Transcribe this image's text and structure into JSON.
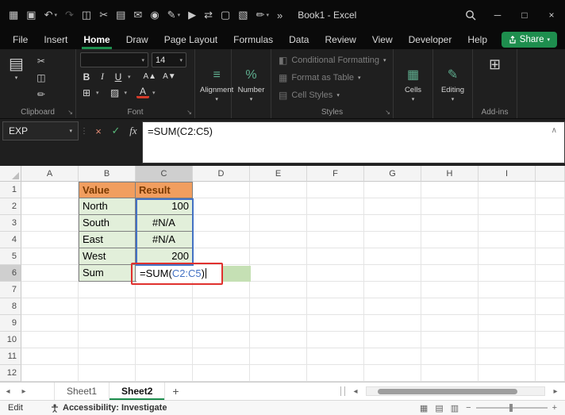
{
  "titlebar": {
    "title": "Book1 - Excel",
    "qat": [
      {
        "name": "app-grid-icon",
        "glyph": "▦"
      },
      {
        "name": "save-icon",
        "glyph": "▣"
      },
      {
        "name": "undo-icon",
        "glyph": "↶",
        "dropdown": true
      },
      {
        "name": "redo-icon",
        "glyph": "↷",
        "dim": true
      },
      {
        "name": "copy-book-icon",
        "glyph": "◫"
      },
      {
        "name": "cut-icon",
        "glyph": "✂"
      },
      {
        "name": "clipboard-icon",
        "glyph": "▤"
      },
      {
        "name": "mail-icon",
        "glyph": "✉"
      },
      {
        "name": "paint-icon",
        "glyph": "◉"
      },
      {
        "name": "pen-icon",
        "glyph": "✎",
        "dropdown": true
      },
      {
        "name": "pointer-icon",
        "glyph": "▶"
      },
      {
        "name": "swap-arrows-icon",
        "glyph": "⇄"
      },
      {
        "name": "camera-icon",
        "glyph": "▢"
      },
      {
        "name": "chart-icon",
        "glyph": "▧"
      },
      {
        "name": "ink-pen-icon",
        "glyph": "✏",
        "dropdown": true
      },
      {
        "name": "more-commands-icon",
        "glyph": "»"
      }
    ],
    "window": {
      "minimize": "─",
      "maximize": "□",
      "close": "×"
    }
  },
  "ui": {
    "caret_down": "▾",
    "dialog_launcher": "↘",
    "formula_collapse": "∧"
  },
  "ribbon": {
    "tabs": [
      {
        "label": "File"
      },
      {
        "label": "Insert"
      },
      {
        "label": "Home",
        "active": true
      },
      {
        "label": "Draw"
      },
      {
        "label": "Page Layout"
      },
      {
        "label": "Formulas"
      },
      {
        "label": "Data"
      },
      {
        "label": "Review"
      },
      {
        "label": "View"
      },
      {
        "label": "Developer"
      },
      {
        "label": "Help"
      }
    ],
    "share_label": "Share",
    "clipboard": {
      "group_label": "Clipboard",
      "paste_icon": "▤",
      "cut_icon": "✂",
      "copy_icon": "◫",
      "format_painter_icon": "✏"
    },
    "font": {
      "group_label": "Font",
      "size": "14",
      "bold": "B",
      "italic": "I",
      "underline": "U",
      "grow": "A▲",
      "shrink": "A▼",
      "borders_icon": "⊞",
      "fill_icon": "▨",
      "font_color_letter": "A"
    },
    "alignment": {
      "label": "Alignment",
      "icon": "≡"
    },
    "number": {
      "label": "Number",
      "icon": "%"
    },
    "styles": {
      "group_label": "Styles",
      "items": [
        {
          "label": "Conditional Formatting",
          "icon": "◧"
        },
        {
          "label": "Format as Table",
          "icon": "▦"
        },
        {
          "label": "Cell Styles",
          "icon": "▤"
        }
      ]
    },
    "cells": {
      "label": "Cells",
      "icon": "▦"
    },
    "editing": {
      "label": "Editing",
      "icon": "✎"
    },
    "addins": {
      "label": "Add-ins",
      "icon": "⊞"
    }
  },
  "formula_bar": {
    "name_box": "EXP",
    "cancel": "×",
    "enter": "✓",
    "fx": "fx",
    "formula": "=SUM(C2:C5)"
  },
  "grid": {
    "col_headers": [
      "A",
      "B",
      "C",
      "D",
      "E",
      "F",
      "G",
      "H",
      "I"
    ],
    "row_headers": [
      "1",
      "2",
      "3",
      "4",
      "5",
      "6",
      "7",
      "8",
      "9",
      "10",
      "11",
      "12"
    ],
    "selected_col": "C",
    "selected_row": "6",
    "cells": [
      {
        "ref": "B1",
        "text": "Value",
        "style": "orange"
      },
      {
        "ref": "C1",
        "text": "Result",
        "style": "orange"
      },
      {
        "ref": "B2",
        "text": "North",
        "style": "green"
      },
      {
        "ref": "C2",
        "text": "100",
        "style": "green",
        "align": "right"
      },
      {
        "ref": "B3",
        "text": "South",
        "style": "green"
      },
      {
        "ref": "C3",
        "text": "#N/A",
        "style": "green",
        "align": "center"
      },
      {
        "ref": "B4",
        "text": "East",
        "style": "green"
      },
      {
        "ref": "C4",
        "text": "#N/A",
        "style": "green",
        "align": "center"
      },
      {
        "ref": "B5",
        "text": "West",
        "style": "green"
      },
      {
        "ref": "C5",
        "text": "200",
        "style": "green",
        "align": "right"
      },
      {
        "ref": "B6",
        "text": "Sum",
        "style": "green"
      }
    ],
    "edit_cell": {
      "ref": "C6",
      "prefix": "=SUM(",
      "range": "C2:C5",
      "suffix": ")"
    },
    "range_highlight": "C2:C5"
  },
  "sheet_bar": {
    "nav_left": "◂",
    "nav_right": "▸",
    "tabs": [
      {
        "label": "Sheet1"
      },
      {
        "label": "Sheet2",
        "active": true
      }
    ],
    "add_label": "+"
  },
  "status_bar": {
    "mode": "Edit",
    "accessibility_label": "Accessibility: Investigate",
    "view_icons": [
      {
        "name": "normal-view-icon",
        "glyph": "▦"
      },
      {
        "name": "page-layout-view-icon",
        "glyph": "▤"
      },
      {
        "name": "page-break-preview-icon",
        "glyph": "▥"
      }
    ],
    "zoom_out": "−",
    "zoom_in": "+"
  },
  "colors": {
    "excel_green": "#1E8E4E",
    "orange_fill": "#F19E5F",
    "orange_text": "#7B3A00",
    "green_fill": "#E2EFDA",
    "overflow_green": "#C5E0B4",
    "ref_blue": "#4472C4",
    "annotation_red": "#E0312E"
  }
}
